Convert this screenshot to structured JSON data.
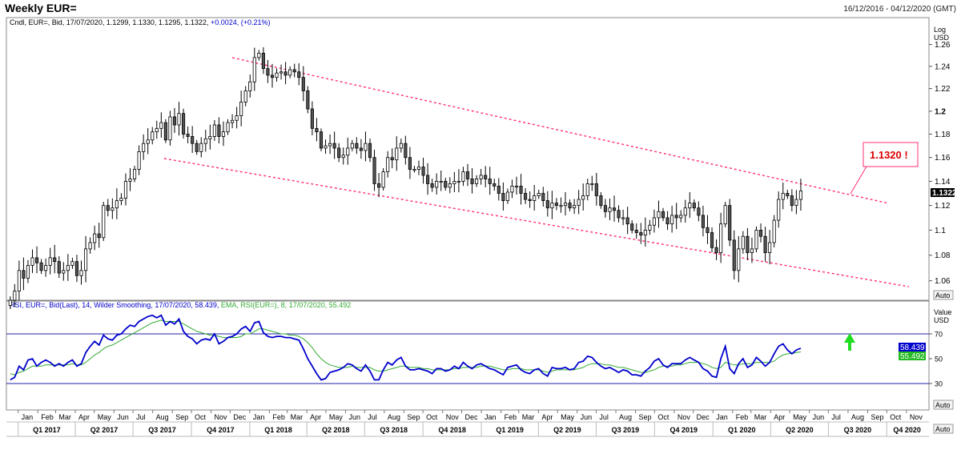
{
  "header": {
    "title": "Weekly EUR=",
    "date_range": "16/12/2016 - 04/12/2020 (GMT)"
  },
  "price_panel": {
    "legend": {
      "prefix": "Cndl, EUR=, Bid, 17/07/2020, 1.1299, 1.1330, 1.1295, 1.1322,",
      "change": "+0.0024, (+0.21%)"
    },
    "axis_title_1": "Log",
    "axis_title_2": "USD",
    "auto_label": "Auto",
    "last_price_label": "1.1322",
    "callout_label": "1.1320  !"
  },
  "rsi_panel": {
    "legend_rsi": "RSI, EUR=, Bid(Last),  14, Wilder Smoothing, 17/07/2020, 58.439,",
    "legend_ema": "EMA, RSI(EUR=),  8, 17/07/2020, 55.492",
    "axis_title_1": "Value",
    "axis_title_2": "USD",
    "auto_label": "Auto",
    "rsi_value_label": "58.439",
    "ema_value_label": "55.492"
  },
  "x_axis": {
    "months": [
      "Jan",
      "Feb",
      "Mar",
      "Apr",
      "May",
      "Jun",
      "Jul",
      "Aug",
      "Sep",
      "Oct",
      "Nov",
      "Dec",
      "Jan",
      "Feb",
      "Mar",
      "Apr",
      "May",
      "Jun",
      "Jul",
      "Aug",
      "Sep",
      "Oct",
      "Nov",
      "Dec",
      "Jan",
      "Feb",
      "Mar",
      "Apr",
      "May",
      "Jun",
      "Jul",
      "Aug",
      "Sep",
      "Oct",
      "Nov",
      "Dec",
      "Jan",
      "Feb",
      "Mar",
      "Apr",
      "May",
      "Jun",
      "Jul",
      "Aug",
      "Sep",
      "Oct",
      "Nov"
    ],
    "quarters": [
      "Q1 2017",
      "Q2 2017",
      "Q3 2017",
      "Q4 2017",
      "Q1 2018",
      "Q2 2018",
      "Q3 2018",
      "Q4 2018",
      "Q1 2019",
      "Q2 2019",
      "Q3 2019",
      "Q4 2019",
      "Q1 2020",
      "Q2 2020",
      "Q3 2020",
      "Q4 2020"
    ],
    "auto_label": "Auto"
  },
  "colors": {
    "candle": "#000000",
    "channel": "#ff2d7a",
    "rsi_line": "#0000cc",
    "ema_line": "#33aa33",
    "callout_text": "#dd0000",
    "arrow": "#22dd22",
    "ref_line": "#2222aa"
  },
  "chart_data": [
    {
      "type": "candlestick",
      "title": "Weekly EUR=",
      "ylabel": "USD",
      "yscale": "log",
      "ylim": [
        1.045,
        1.285
      ],
      "yticks": [
        1.06,
        1.08,
        1.1,
        1.12,
        1.14,
        1.16,
        1.18,
        1.2,
        1.22,
        1.24,
        1.26
      ],
      "xlim": [
        "2016-12-16",
        "2020-12-04"
      ],
      "series": [
        {
          "week_start": "2016-12-16",
          "close": [
            1.045,
            1.052,
            1.068,
            1.062,
            1.072,
            1.078,
            1.074,
            1.068,
            1.072,
            1.078,
            1.075,
            1.066,
            1.068,
            1.072,
            1.075,
            1.064,
            1.068,
            1.085,
            1.09,
            1.097,
            1.094,
            1.12,
            1.116,
            1.118,
            1.124,
            1.126,
            1.14,
            1.142,
            1.15,
            1.165,
            1.172,
            1.175,
            1.182,
            1.185,
            1.19,
            1.175,
            1.195,
            1.188,
            1.198,
            1.18,
            1.178,
            1.172,
            1.165,
            1.172,
            1.176,
            1.178,
            1.188,
            1.178,
            1.182,
            1.19,
            1.192,
            1.196,
            1.208,
            1.218,
            1.226,
            1.248,
            1.252,
            1.238,
            1.232,
            1.23,
            1.234,
            1.235,
            1.232,
            1.237,
            1.235,
            1.23,
            1.218,
            1.202,
            1.185,
            1.182,
            1.168,
            1.17,
            1.172,
            1.168,
            1.16,
            1.162,
            1.168,
            1.172,
            1.168,
            1.166,
            1.172,
            1.16,
            1.138,
            1.135,
            1.148,
            1.16,
            1.158,
            1.168,
            1.172,
            1.16,
            1.15,
            1.15,
            1.152,
            1.145,
            1.138,
            1.135,
            1.14,
            1.14,
            1.135,
            1.138,
            1.14,
            1.14,
            1.148,
            1.142,
            1.138,
            1.142,
            1.145,
            1.142,
            1.138,
            1.136,
            1.13,
            1.124,
            1.131,
            1.136,
            1.136,
            1.13,
            1.125,
            1.124,
            1.128,
            1.13,
            1.124,
            1.118,
            1.122,
            1.12,
            1.12,
            1.122,
            1.118,
            1.12,
            1.125,
            1.128,
            1.138,
            1.138,
            1.128,
            1.12,
            1.115,
            1.118,
            1.116,
            1.11,
            1.11,
            1.105,
            1.1,
            1.098,
            1.096,
            1.1,
            1.104,
            1.11,
            1.115,
            1.11,
            1.105,
            1.112,
            1.11,
            1.112,
            1.118,
            1.122,
            1.118,
            1.112,
            1.102,
            1.098,
            1.086,
            1.082,
            1.105,
            1.12,
            1.092,
            1.068,
            1.085,
            1.095,
            1.082,
            1.085,
            1.1,
            1.095,
            1.082,
            1.09,
            1.108,
            1.125,
            1.13,
            1.128,
            1.12,
            1.125,
            1.132
          ]
        }
      ]
    },
    {
      "type": "line",
      "ylabel": "Value",
      "ylim": [
        10,
        90
      ],
      "yticks": [
        30,
        50,
        70
      ],
      "reference_lines": [
        30,
        70
      ],
      "series": [
        {
          "name": "RSI, EUR=, Bid(Last), 14, Wilder Smoothing",
          "last": 58.439,
          "values": [
            33,
            35,
            44,
            41,
            49,
            50,
            44,
            47,
            49,
            47,
            44,
            46,
            44,
            47,
            49,
            44,
            46,
            55,
            60,
            64,
            61,
            69,
            66,
            65,
            69,
            70,
            74,
            77,
            76,
            80,
            82,
            84,
            85,
            83,
            85,
            77,
            80,
            78,
            82,
            72,
            68,
            66,
            62,
            65,
            66,
            65,
            70,
            62,
            64,
            67,
            68,
            70,
            74,
            76,
            72,
            79,
            80,
            71,
            68,
            67,
            68,
            68,
            67,
            67,
            66,
            65,
            58,
            50,
            44,
            38,
            33,
            34,
            39,
            40,
            41,
            43,
            46,
            45,
            42,
            40,
            45,
            40,
            33,
            33,
            41,
            47,
            45,
            49,
            51,
            44,
            41,
            41,
            42,
            41,
            40,
            38,
            42,
            42,
            40,
            41,
            44,
            42,
            47,
            44,
            42,
            45,
            46,
            44,
            42,
            41,
            39,
            37,
            43,
            44,
            45,
            41,
            39,
            38,
            41,
            42,
            38,
            36,
            43,
            42,
            42,
            43,
            41,
            42,
            47,
            48,
            52,
            51,
            47,
            44,
            42,
            43,
            41,
            39,
            41,
            40,
            37,
            37,
            36,
            40,
            43,
            48,
            50,
            45,
            43,
            46,
            46,
            46,
            49,
            51,
            49,
            47,
            42,
            40,
            36,
            35,
            50,
            60,
            42,
            38,
            46,
            50,
            43,
            45,
            51,
            48,
            44,
            47,
            54,
            60,
            62,
            57,
            54,
            57,
            58.439
          ]
        },
        {
          "name": "EMA, RSI(EUR=), 8",
          "last": 55.492,
          "values": [
            38,
            37,
            39,
            40,
            42,
            44,
            44,
            44,
            45,
            45,
            45,
            45,
            45,
            45,
            46,
            45,
            45,
            47,
            50,
            53,
            55,
            58,
            60,
            61,
            63,
            65,
            67,
            69,
            71,
            73,
            75,
            77,
            79,
            80,
            81,
            80,
            80,
            80,
            80,
            78,
            76,
            74,
            72,
            71,
            70,
            69,
            69,
            68,
            67,
            67,
            67,
            67,
            68,
            70,
            70,
            72,
            74,
            74,
            73,
            72,
            71,
            70,
            70,
            69,
            69,
            68,
            66,
            63,
            59,
            54,
            50,
            47,
            45,
            44,
            43,
            43,
            43,
            44,
            43,
            43,
            43,
            43,
            41,
            40,
            40,
            41,
            42,
            43,
            44,
            44,
            43,
            43,
            43,
            42,
            42,
            41,
            41,
            41,
            41,
            41,
            42,
            42,
            43,
            43,
            43,
            43,
            44,
            44,
            44,
            43,
            42,
            41,
            41,
            42,
            42,
            42,
            41,
            41,
            41,
            41,
            40,
            39,
            40,
            41,
            41,
            41,
            41,
            41,
            42,
            43,
            45,
            46,
            46,
            46,
            45,
            45,
            44,
            43,
            43,
            42,
            41,
            40,
            39,
            39,
            40,
            41,
            43,
            44,
            44,
            44,
            45,
            45,
            46,
            47,
            47,
            47,
            46,
            45,
            43,
            42,
            43,
            47,
            46,
            45,
            45,
            46,
            46,
            46,
            47,
            47,
            47,
            47,
            48,
            51,
            53,
            54,
            54,
            55,
            55.492
          ]
        }
      ]
    }
  ]
}
